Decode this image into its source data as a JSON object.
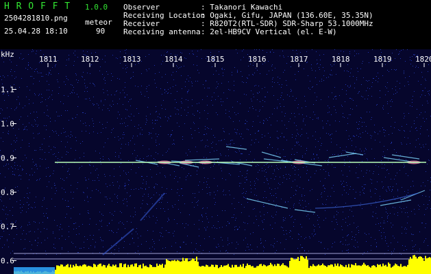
{
  "app": {
    "name": "H R O F F T",
    "version": "1.0.0"
  },
  "file": {
    "name": "2504281810.png",
    "datetime": "25.04.28 18:10"
  },
  "detection": {
    "label": "meteor",
    "value": "90"
  },
  "info": [
    {
      "label": "Observer",
      "value": ": Takanori Kawachi"
    },
    {
      "label": "Receiving Location",
      "value": ": Ogaki, Gifu, JAPAN (136.60E, 35.35N)"
    },
    {
      "label": "Receiver",
      "value": ": R820T2(RTL-SDR) SDR-Sharp 53.1000MHz"
    },
    {
      "label": "Receiving antenna",
      "value": ": 2el-HB9CV Vertical (el. E-W)"
    }
  ],
  "axis": {
    "unit": "kHz",
    "time_ticks": [
      "1811",
      "1812",
      "1813",
      "1814",
      "1815",
      "1816",
      "1817",
      "1818",
      "1819",
      "1820"
    ],
    "freq_ticks": [
      "1.1",
      "1.0",
      "0.9",
      "0.8",
      "0.7",
      "0.6"
    ]
  },
  "colors": {
    "background": "#06062c",
    "header_text_green": "#33e833",
    "carrier": "#b8ffb8",
    "echo": "#7fd9ff",
    "histogram": "#ffff00"
  }
}
